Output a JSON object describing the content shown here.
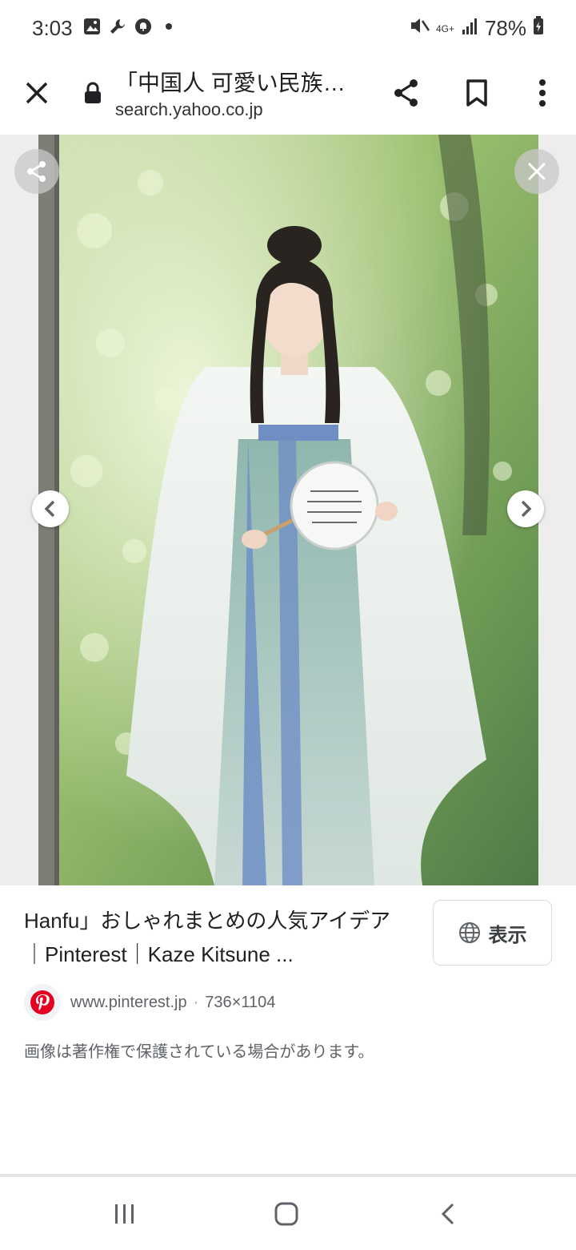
{
  "status_bar": {
    "time": "3:03",
    "network": "4G+",
    "battery": "78%",
    "icons_left": [
      "gallery-icon",
      "wrench-icon",
      "notification-icon",
      "dot-icon"
    ],
    "icons_right": [
      "mute-icon",
      "network-icon",
      "signal-icon",
      "battery-icon"
    ]
  },
  "browser": {
    "title": "「中国人 可愛い民族…",
    "url": "search.yahoo.co.jp",
    "actions": [
      "share-icon",
      "bookmark-icon",
      "more-icon"
    ]
  },
  "viewer": {
    "image_description": "Woman in white and blue hanfu holding a round fan in a sunny green forest",
    "buttons": [
      "share",
      "close",
      "previous",
      "next"
    ]
  },
  "result": {
    "title": "Hanfu」おしゃれまとめの人気アイデア｜Pinterest｜Kaze Kitsune ...",
    "view_button_label": "表示",
    "source_domain": "www.pinterest.jp",
    "separator": "·",
    "dimensions": "736×1104",
    "copyright_notice": "画像は著作権で保護されている場合があります。"
  },
  "colors": {
    "pinterest_red": "#e60023",
    "text_primary": "#202124",
    "text_secondary": "#5f6368"
  }
}
